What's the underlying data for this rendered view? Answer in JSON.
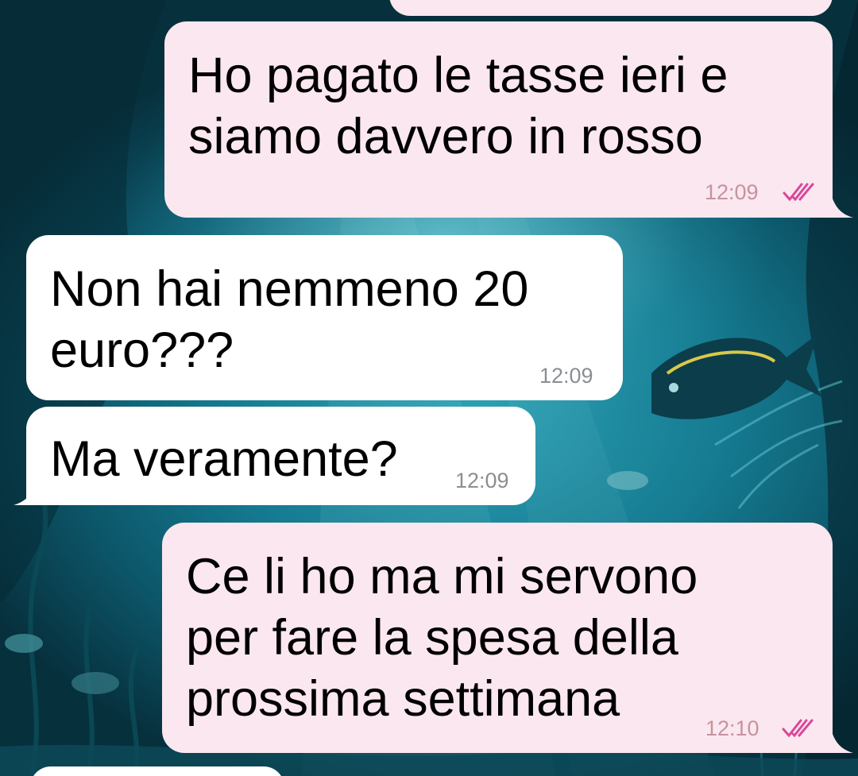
{
  "messages": [
    {
      "direction": "outgoing",
      "text": "Ho pagato le tasse ieri e\nsiamo davvero in rosso",
      "time": "12:09",
      "status": "read-double-check-icon"
    },
    {
      "direction": "incoming",
      "text": "Non hai nemmeno 20\neuro???",
      "time": "12:09"
    },
    {
      "direction": "incoming",
      "text": "Ma veramente?",
      "time": "12:09"
    },
    {
      "direction": "outgoing",
      "text": "Ce li ho ma mi servono\nper fare la spesa della\nprossima settimana",
      "time": "12:10",
      "status": "read-double-check-icon"
    }
  ],
  "colors": {
    "outgoing_bubble": "#fbe7ef",
    "incoming_bubble": "#ffffff",
    "read_ticks": "#d9479a",
    "timestamp_incoming": "#8b8f92",
    "timestamp_outgoing": "#c6929f"
  },
  "background": "underwater-fish-wallpaper"
}
